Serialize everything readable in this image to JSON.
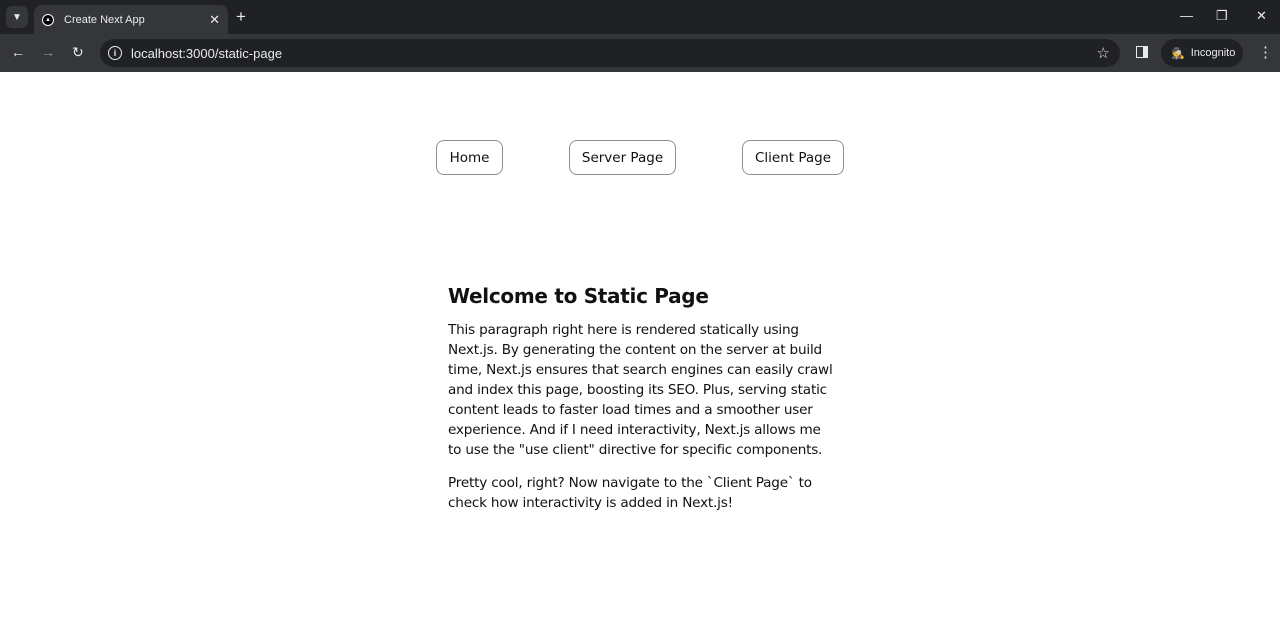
{
  "browser": {
    "tab_title": "Create Next App",
    "url": "localhost:3000/static-page",
    "profile_label": "Incognito"
  },
  "nav_links": [
    {
      "label": "Home"
    },
    {
      "label": "Server Page"
    },
    {
      "label": "Client Page"
    }
  ],
  "content": {
    "heading": "Welcome to Static Page",
    "paragraph1": "This paragraph right here is rendered statically using Next.js. By generating the content on the server at build time, Next.js ensures that search engines can easily crawl and index this page, boosting its SEO. Plus, serving static content leads to faster load times and a smoother user experience. And if I need interactivity, Next.js allows me to use the \"use client\" directive for specific components.",
    "paragraph2": "Pretty cool, right? Now navigate to the `Client Page` to check how interactivity is added in Next.js!"
  }
}
